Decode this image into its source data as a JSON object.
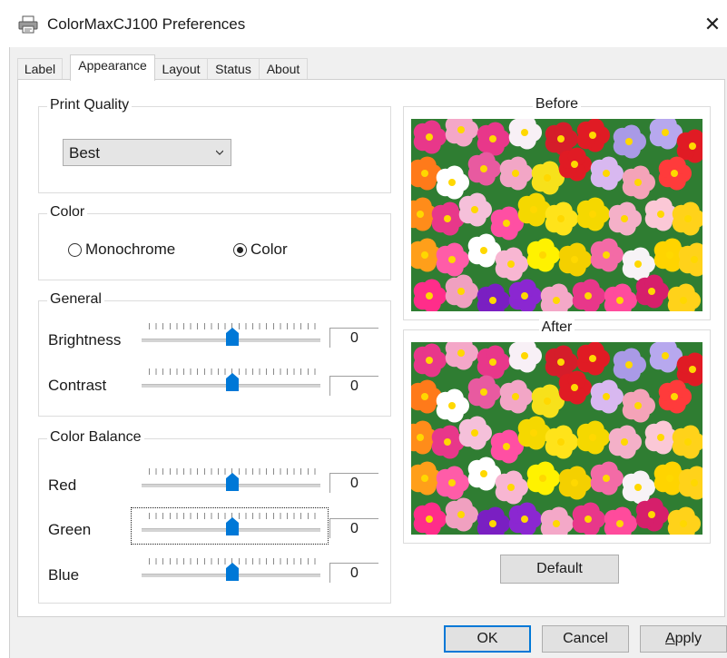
{
  "window": {
    "title": "ColorMaxCJ100 Preferences",
    "close_glyph": "✕"
  },
  "tabs": [
    {
      "label": "Label",
      "active": false
    },
    {
      "label": "Appearance",
      "active": true
    },
    {
      "label": "Layout",
      "active": false
    },
    {
      "label": "Status",
      "active": false
    },
    {
      "label": "About",
      "active": false
    }
  ],
  "print_quality": {
    "legend": "Print Quality",
    "selected": "Best"
  },
  "color": {
    "legend": "Color",
    "options": [
      {
        "label": "Monochrome",
        "checked": false
      },
      {
        "label": "Color",
        "checked": true
      }
    ]
  },
  "general": {
    "legend": "General",
    "sliders": [
      {
        "label": "Brightness",
        "value": "0",
        "position": 0.5
      },
      {
        "label": "Contrast",
        "value": "0",
        "position": 0.5
      }
    ]
  },
  "color_balance": {
    "legend": "Color Balance",
    "sliders": [
      {
        "label": "Red",
        "value": "0",
        "position": 0.5
      },
      {
        "label": "Green",
        "value": "0",
        "position": 0.5,
        "focused": true
      },
      {
        "label": "Blue",
        "value": "0",
        "position": 0.5
      }
    ]
  },
  "preview": {
    "before_label": "Before",
    "after_label": "After",
    "default_button": "Default"
  },
  "footer": {
    "ok": "OK",
    "cancel": "Cancel",
    "apply": "Apply"
  },
  "colors": {
    "accent": "#0078d7",
    "thumb": "#0078d7"
  }
}
